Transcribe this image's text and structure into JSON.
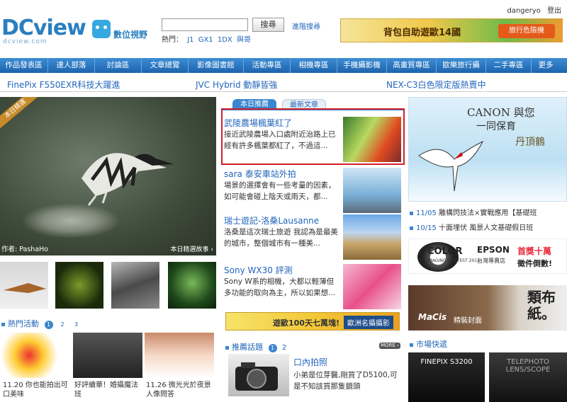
{
  "header": {
    "logo_text": "DCview",
    "logo_sub": "dcview.com",
    "logo_tag": "數位視野",
    "search_button": "搜尋",
    "advanced_search": "進階搜尋",
    "hot_keywords_label": "熱門：",
    "hot_keywords": [
      "J1",
      "GX1",
      "1DX",
      "與哥"
    ],
    "user_name": "dangeryo",
    "logout": "登出",
    "top_banner_text": "背包自助遊歐14國",
    "top_banner_badge": "旅行危險機"
  },
  "nav": {
    "items": [
      "作品發表區",
      "達人部落",
      "討論區",
      "文章總覽",
      "影像圖書館",
      "活動專區",
      "相機專區",
      "手機攝影機",
      "高畫質專區",
      "歐樂旅行攝",
      "二手專區",
      "更多"
    ]
  },
  "promos": [
    "FinePix F550EXR科技大躍進",
    "JVC Hybrid 動靜皆強",
    "NEX-C3白色限定版熱賣中"
  ],
  "feature": {
    "corner_label": "本日精選",
    "author": "作者: PashaHo",
    "story_link": "本日精選故事 ›"
  },
  "hot_activity": {
    "title": "熱門活動",
    "pages": [
      "1",
      "2",
      "3"
    ],
    "items": [
      {
        "caption": "11.20 你也能拍出可口美味"
      },
      {
        "caption": "好評續華！婚攝魔法班"
      },
      {
        "caption": "11.26 微光光於夜景人像問答"
      }
    ]
  },
  "middle": {
    "tabs": [
      "本日推薦",
      "最新文章"
    ],
    "articles": [
      {
        "title": "武陵農場楓葉紅了",
        "desc": "接近武陵農場入口處附近治路上已經有許多楓葉都紅了，不過這..."
      },
      {
        "title": "sara 泰安車站外拍",
        "desc": "場景的選擇會有一些考量的因素，如可能會碰上陰天或雨天，都..."
      },
      {
        "title": "瑞士遊記-洛桑Lausanne",
        "desc": "洛桑是這次瑞士旅遊 我認為是最美的城市，整個城市有一種美..."
      },
      {
        "title": "Sony WX30 評測",
        "desc": "Sony W系的相機，大都以輕薄但多功能的取向為主，所以如果想..."
      }
    ],
    "banner_text": "遊歐100天七萬塊!",
    "banner_badge": "歐洲名攝攝影",
    "rec_title": "推薦話題",
    "rec_pages": [
      "1",
      "2"
    ],
    "more": "MORE ›",
    "rec_item_title": "口內拍照",
    "rec_item_desc": "小弟是位芽醫,剛買了D5100,可是不知該買那隻鏡頭"
  },
  "right": {
    "canon_line1": "CANON 與您",
    "canon_line2": "一同保育",
    "canon_line3": "丹頂鶴",
    "news": [
      {
        "date": "11/05",
        "text": "雕構閃技法×實戰應用【基礎班"
      },
      {
        "date": "10/15",
        "text": "十面埋伏 風景人文基礎假日班"
      }
    ],
    "color_title": "COLOR",
    "color_sub": "IMAGING CONTEST 2011",
    "epson": "EPSON",
    "epson_sub": "台灣專賣店",
    "prize": "首獎十萬",
    "prize_sub": "徵件倒數!",
    "macis_brand": "MaCis",
    "macis_text": "精裝封面",
    "macis_big": "類布紙。",
    "market_title": "市場快遞",
    "market_labels": [
      "FINEPIX S3200",
      "TELEPHOTO LENS/SCOPE"
    ]
  },
  "colors": {
    "accent": "#2266bb",
    "nav_bg": "#1d63ad",
    "highlight": "#d0202a"
  }
}
